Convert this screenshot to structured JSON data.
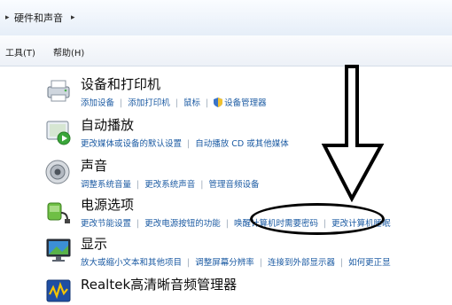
{
  "address_bar": {
    "lead_arrow": "▸",
    "breadcrumb": "硬件和声音",
    "trail_arrow": "▸"
  },
  "menu": {
    "tools": "工具(T)",
    "help": "帮助(H)"
  },
  "categories": [
    {
      "title": "设备和打印机",
      "links": [
        "添加设备",
        "添加打印机",
        "鼠标",
        "设备管理器"
      ]
    },
    {
      "title": "自动播放",
      "links": [
        "更改媒体或设备的默认设置",
        "自动播放 CD 或其他媒体"
      ]
    },
    {
      "title": "声音",
      "links": [
        "调整系统音量",
        "更改系统声音",
        "管理音频设备"
      ]
    },
    {
      "title": "电源选项",
      "links": [
        "更改节能设置",
        "更改电源按钮的功能",
        "唤醒计算机时需要密码",
        "更改计算机睡眠"
      ]
    },
    {
      "title": "显示",
      "links": [
        "放大或缩小文本和其他项目",
        "调整屏幕分辨率",
        "连接到外部显示器",
        "如何更正显"
      ]
    },
    {
      "title": "Realtek高清晰音频管理器",
      "links": []
    }
  ],
  "annotation": {
    "arrow_color": "#000000",
    "oval_color": "#000000"
  },
  "colors": {
    "link": "#1c5ba3",
    "title": "#0b0b0b"
  }
}
